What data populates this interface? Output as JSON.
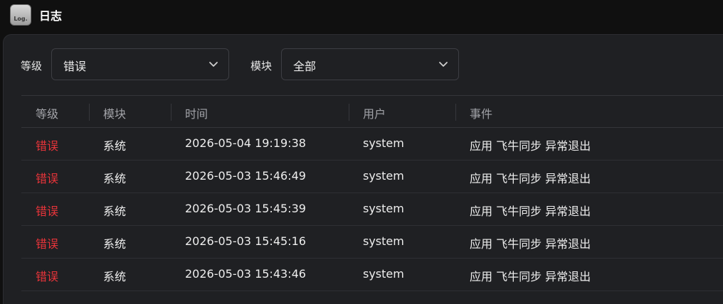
{
  "app": {
    "icon_text": "Log.",
    "title": "日志"
  },
  "filters": {
    "level_label": "等级",
    "level_value": "错误",
    "module_label": "模块",
    "module_value": "全部"
  },
  "table": {
    "columns": [
      "等级",
      "模块",
      "时间",
      "用户",
      "事件"
    ],
    "rows": [
      {
        "level": "错误",
        "module": "系统",
        "time": "2026-05-04 19:19:38",
        "user": "system",
        "event": "应用 飞牛同步 异常退出"
      },
      {
        "level": "错误",
        "module": "系统",
        "time": "2026-05-03 15:46:49",
        "user": "system",
        "event": "应用 飞牛同步 异常退出"
      },
      {
        "level": "错误",
        "module": "系统",
        "time": "2026-05-03 15:45:39",
        "user": "system",
        "event": "应用 飞牛同步 异常退出"
      },
      {
        "level": "错误",
        "module": "系统",
        "time": "2026-05-03 15:45:16",
        "user": "system",
        "event": "应用 飞牛同步 异常退出"
      },
      {
        "level": "错误",
        "module": "系统",
        "time": "2026-05-03 15:43:46",
        "user": "system",
        "event": "应用 飞牛同步 异常退出"
      }
    ]
  },
  "colors": {
    "error": "#e8343a",
    "background": "#1f2023",
    "titlebar": "#101010"
  }
}
